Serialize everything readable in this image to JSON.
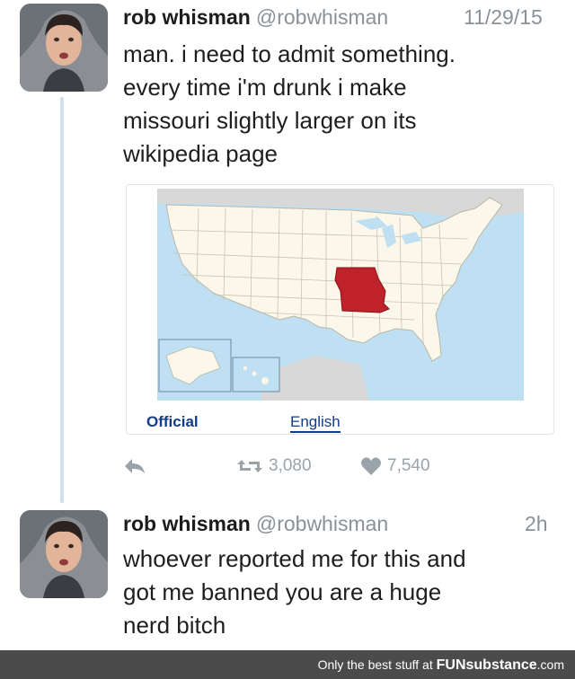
{
  "tweets": [
    {
      "name": "rob whisman",
      "handle": "@robwhisman",
      "time": "11/29/15",
      "lines": [
        "man. i need to admit something.",
        "every time i'm drunk i make",
        "missouri slightly larger on its",
        "wikipedia page"
      ],
      "card": {
        "tab_official": "Official",
        "tab_english": "English"
      },
      "actions": {
        "retweets": "3,080",
        "likes": "7,540"
      }
    },
    {
      "name": "rob whisman",
      "handle": "@robwhisman",
      "time": "2h",
      "lines": [
        "whoever reported me for this and",
        "got me banned you are a huge",
        "nerd bitch"
      ]
    }
  ],
  "footer": {
    "text": "Only the best stuff at",
    "brand": "FUNsubstance",
    "tld": ".com"
  },
  "colors": {
    "missouri": "#c0222c",
    "map_land": "#fbf7ea",
    "map_water": "#bfe0f2",
    "link": "#123c8a"
  }
}
